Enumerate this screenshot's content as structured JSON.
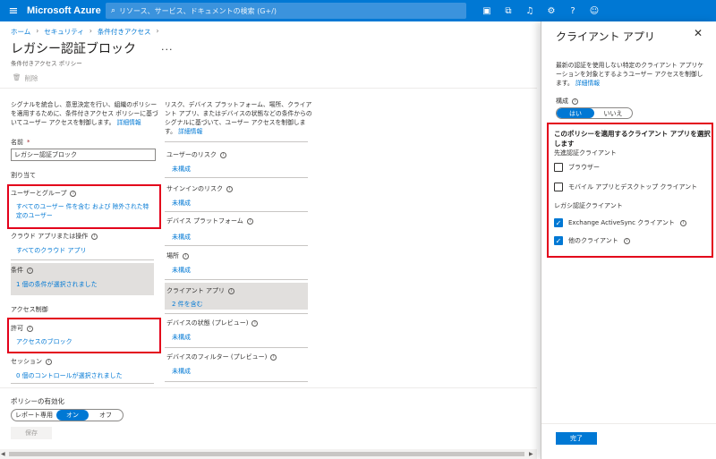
{
  "topbar": {
    "brand": "Microsoft Azure",
    "search_placeholder": "リソース、サービス、ドキュメントの検索 (G+/)"
  },
  "breadcrumb": [
    "ホーム",
    "セキュリティ",
    "条件付きアクセス"
  ],
  "page": {
    "title": "レガシー認証ブロック",
    "subtitle": "条件付きアクセス ポリシー",
    "delete_label": "削除",
    "more": "..."
  },
  "left": {
    "description": "シグナルを統合し、意思決定を行い、組織のポリシーを適用するために、条件付きアクセス ポリシーに基づいてユーザー アクセスを制御します。",
    "learn_more": "詳細情報",
    "name_label": "名前",
    "name_value": "レガシー認証ブロック",
    "assignments_label": "割り当て",
    "users_label": "ユーザーとグループ",
    "users_value": "すべてのユーザー 件を含む および 除外された特定のユーザー",
    "cloud_apps_label": "クラウド アプリまたは操作",
    "cloud_apps_value": "すべてのクラウド アプリ",
    "conditions_label": "条件",
    "conditions_value": "1 個の条件が選択されました",
    "access_controls_label": "アクセス制御",
    "grant_label": "許可",
    "grant_value": "アクセスのブロック",
    "session_label": "セッション",
    "session_value": "0 個のコントロールが選択されました"
  },
  "right": {
    "description": "リスク、デバイス プラットフォーム、場所、クライアント アプリ、またはデバイスの状態などの条件からのシグナルに基づいて、ユーザー アクセスを制御します。",
    "learn_more": "詳細情報",
    "conditions": [
      {
        "label": "ユーザーのリスク",
        "value": "未構成"
      },
      {
        "label": "サインインのリスク",
        "value": "未構成"
      },
      {
        "label": "デバイス プラットフォーム",
        "value": "未構成"
      },
      {
        "label": "場所",
        "value": "未構成"
      },
      {
        "label": "クライアント アプリ",
        "value": "2 件を含む"
      },
      {
        "label": "デバイスの状態 (プレビュー)",
        "value": "未構成"
      },
      {
        "label": "デバイスのフィルター (プレビュー)",
        "value": "未構成"
      }
    ]
  },
  "bottom": {
    "enable_label": "ポリシーの有効化",
    "toggle": [
      "レポート専用",
      "オン",
      "オフ"
    ],
    "save": "保存"
  },
  "panel": {
    "title": "クライアント アプリ",
    "description": "最新の認証を使用しない特定のクライアント アプリケーションを対象とするようユーザー アクセスを制御します。",
    "learn_more": "詳細情報",
    "configure_label": "構成",
    "yes": "はい",
    "no": "いいえ",
    "select_title": "このポリシーを適用するクライアント アプリを選択します",
    "modern_section": "先進認証クライアント",
    "browser": "ブラウザー",
    "mobile_desktop": "モバイル アプリとデスクトップ クライアント",
    "legacy_section": "レガシ認証クライアント",
    "exchange": "Exchange ActiveSync クライアント",
    "other_clients": "他のクライアント",
    "done": "完了"
  },
  "colors": {
    "accent": "#0078d4",
    "highlight": "#e3001b"
  }
}
